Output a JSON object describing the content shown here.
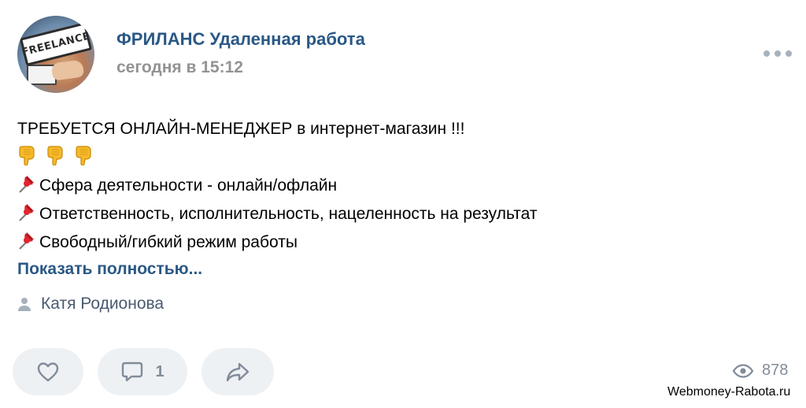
{
  "post": {
    "author": "ФРИЛАНС Удаленная работа",
    "time": "сегодня в 15:12",
    "avatar_text": "FREELANCE",
    "lines": [
      "ТРЕБУЕТСЯ ОНЛАЙН-МЕНЕДЖЕР в интернет-магазин !!!",
      "Сфера деятельности - онлайн/офлайн",
      "Ответственность, исполнительность, нацеленность на результат",
      "Свободный/гибкий режим работы"
    ],
    "show_more": "Показать полностью...",
    "signer": "Катя Родионова",
    "icons": {
      "emoji_row": [
        "pointing-down-hand-icon",
        "pointing-down-hand-icon",
        "pointing-down-hand-icon"
      ],
      "bullet": "pushpin-icon"
    }
  },
  "actions": {
    "like_icon": "heart-icon",
    "comment_icon": "comment-icon",
    "comment_count": "1",
    "share_icon": "share-arrow-icon",
    "views_icon": "eye-icon",
    "views_count": "878"
  },
  "watermark": "Webmoney-Rabota.ru",
  "colors": {
    "link": "#2a5885",
    "secondary": "#939393",
    "action_bg": "#eef1f4",
    "action_icon": "#818c99"
  }
}
